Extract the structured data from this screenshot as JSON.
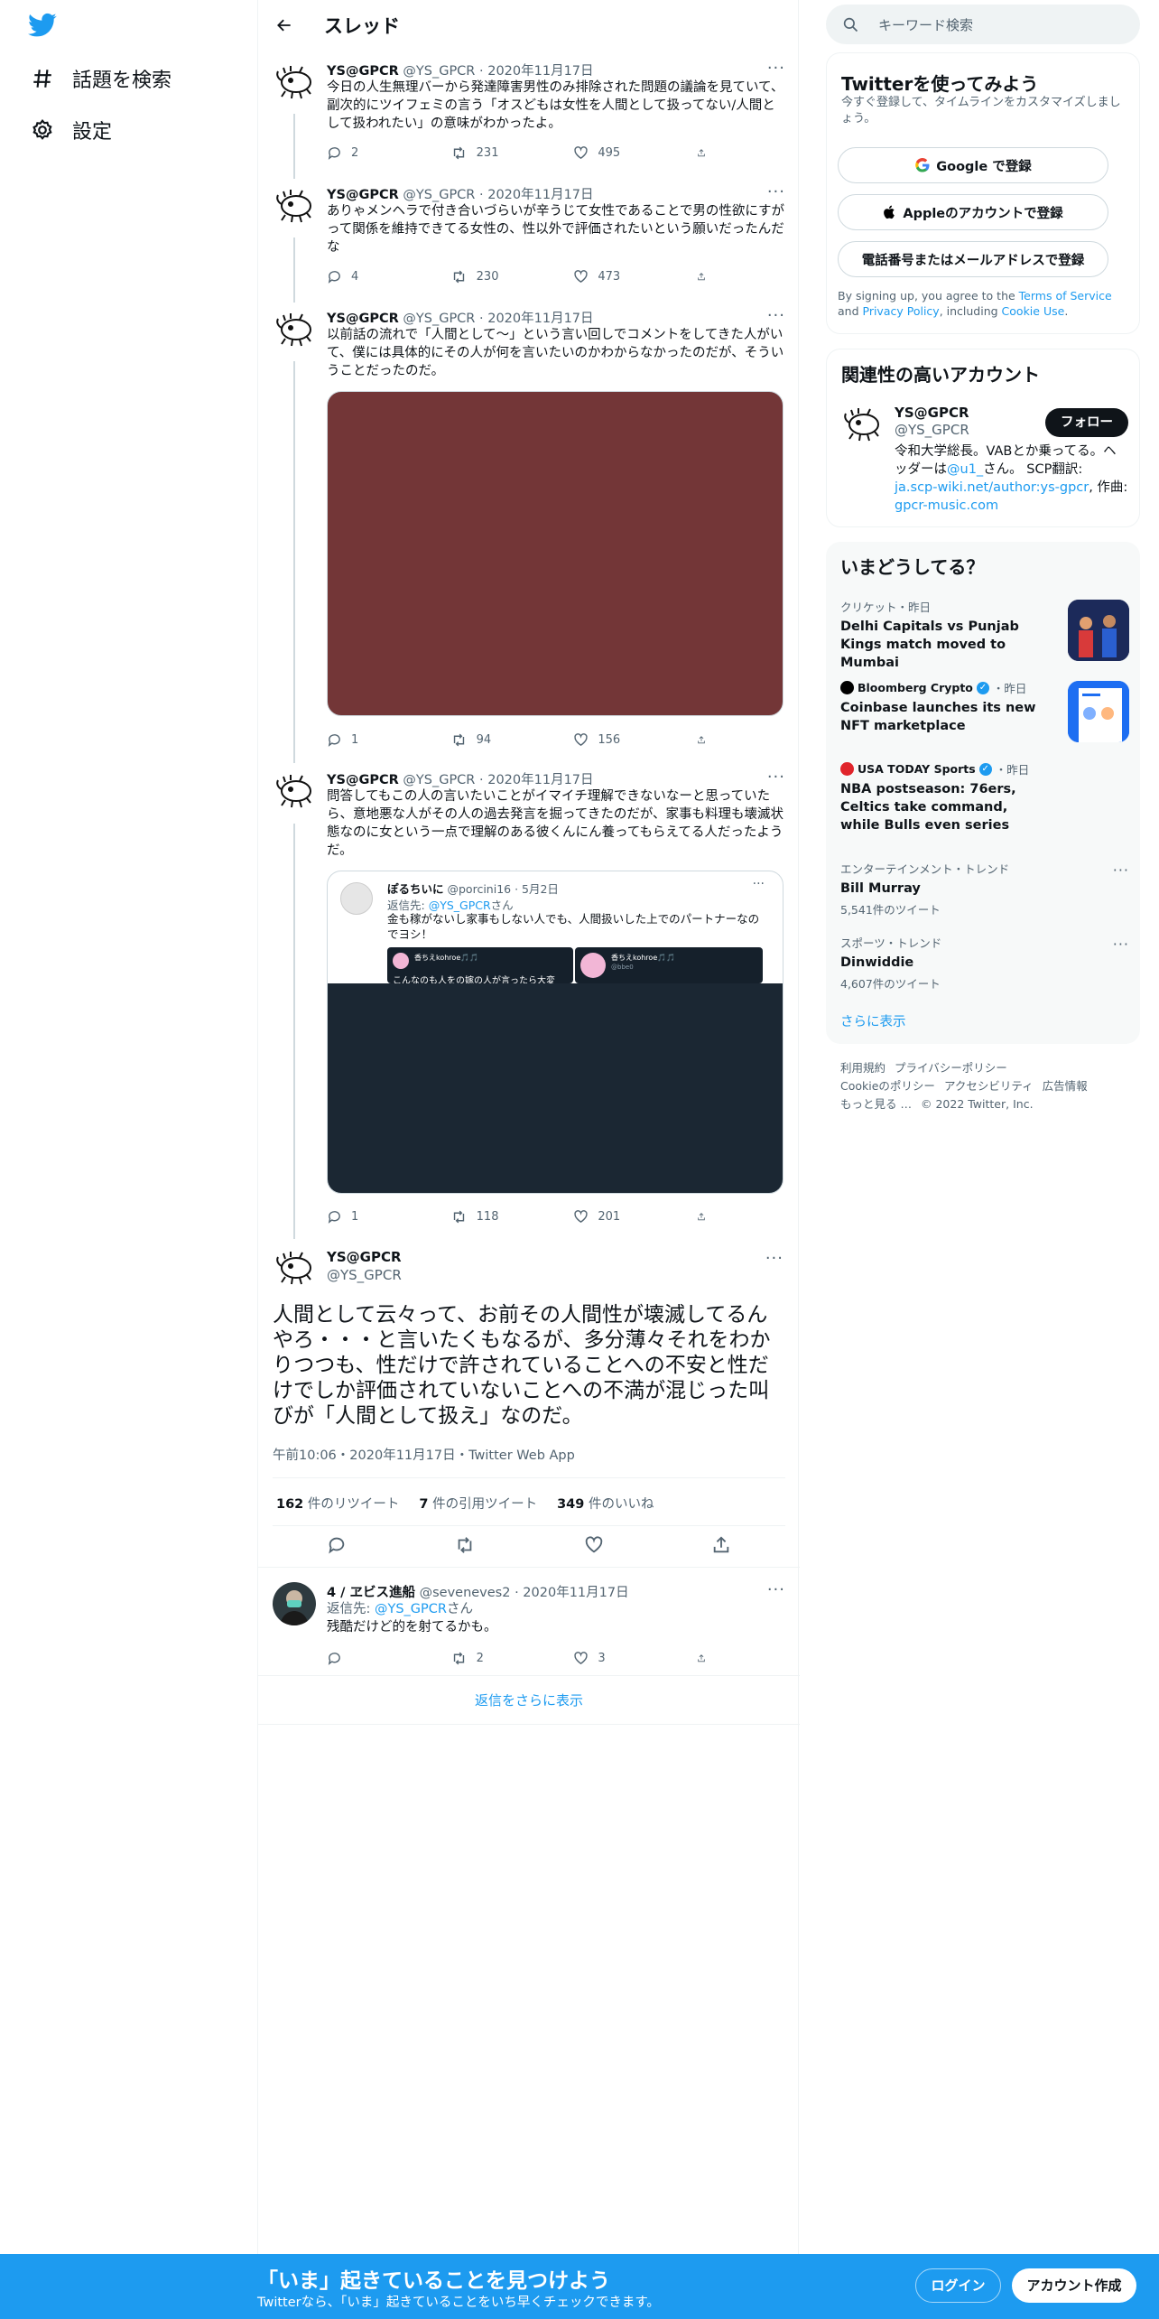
{
  "nav": {
    "logo": "twitter-bird",
    "explore_label": "話題を検索",
    "settings_label": "設定"
  },
  "header": {
    "title": "スレッド"
  },
  "tweets": [
    {
      "name": "YS@GPCR",
      "handle": "@YS_GPCR",
      "date": "2020年11月17日",
      "text": "今日の人生無理バーから発達障害男性のみ排除された問題の議論を見ていて、副次的にツイフェミの言う「オスどもは女性を人間として扱ってない/人間として扱われたい」の意味がわかったよ。",
      "replies": "2",
      "retweets": "231",
      "likes": "495"
    },
    {
      "name": "YS@GPCR",
      "handle": "@YS_GPCR",
      "date": "2020年11月17日",
      "text": "ありゃメンヘラで付き合いづらいが辛うじて女性であることで男の性欲にすがって関係を維持できてる女性の、性以外で評価されたいという願いだったんだな",
      "replies": "4",
      "retweets": "230",
      "likes": "473"
    },
    {
      "name": "YS@GPCR",
      "handle": "@YS_GPCR",
      "date": "2020年11月17日",
      "text": "以前話の流れで「人間として～」という言い回しでコメントをしてきた人がいて、僕には具体的にその人が何を言いたいのかわからなかったのだが、そういうことだったのだ。",
      "replies": "1",
      "retweets": "94",
      "likes": "156"
    },
    {
      "name": "YS@GPCR",
      "handle": "@YS_GPCR",
      "date": "2020年11月17日",
      "text": "問答してもこの人の言いたいことがイマイチ理解できないなーと思っていたら、意地悪な人がその人の過去発言を掘ってきたのだが、家事も料理も壊滅状態なのに女という一点で理解のある彼くんにん養ってもらえてる人だったようだ。",
      "replies": "1",
      "retweets": "118",
      "likes": "201"
    }
  ],
  "quote": {
    "name": "ぽるちいに",
    "handle": "@porcini16",
    "date": "5月2日",
    "reply_to_prefix": "返信先: ",
    "reply_to": "@YS_GPCR",
    "reply_to_suffix": "さん",
    "text": "金も稼がないし家事もしない人でも、人間扱いした上でのパートナーなのでヨシ！",
    "thumb1_name": "香ちえkohroe🎵🎵",
    "thumb1_text": "こんなのも人をの嫁の人が言ったら大変",
    "thumb2_name": "香ちえkohroe🎵🎵",
    "thumb2_handle": "@bbe0"
  },
  "main": {
    "name": "YS@GPCR",
    "handle": "@YS_GPCR",
    "text": "人間として云々って、お前その人間性が壊滅してるんやろ・・・と言いたくもなるが、多分薄々それをわかりつつも、性だけで許されていることへの不安と性だけでしか評価されていないことへの不満が混じった叫びが「人間として扱え」なのだ。",
    "time": "午前10:06・2020年11月17日・Twitter Web App",
    "retweet_count": "162",
    "retweet_label": " 件のリツイート",
    "quote_count": "7",
    "quote_label": " 件の引用ツイート",
    "like_count": "349",
    "like_label": " 件のいいね"
  },
  "reply": {
    "name": "4 / ヱビス進船",
    "handle": "@seveneves2",
    "date": "2020年11月17日",
    "reply_to_prefix": "返信先: ",
    "reply_to": "@YS_GPCR",
    "reply_to_suffix": "さん",
    "text": "残酷だけど的を射てるかも。",
    "replies": "",
    "retweets": "2",
    "likes": "3"
  },
  "show_more_replies": "返信をさらに表示",
  "search": {
    "placeholder": "キーワード検索"
  },
  "signup": {
    "title": "Twitterを使ってみよう",
    "desc": "今すぐ登録して、タイムラインをカスタマイズしましょう。",
    "google": "Google で登録",
    "apple": "Appleのアカウントで登録",
    "phone": "電話番号またはメールアドレスで登録",
    "terms_pre": "By signing up, you agree to the ",
    "terms_link": "Terms of Service",
    "terms_mid": " and ",
    "privacy_link": "Privacy Policy",
    "terms_mid2": ", including ",
    "cookie_link": "Cookie Use",
    "terms_end": "."
  },
  "related": {
    "title": "関連性の高いアカウント",
    "name": "YS@GPCR",
    "handle": "@YS_GPCR",
    "follow": "フォロー",
    "bio_1": "令和大学総長。VABとか乗ってる。ヘッダーは",
    "bio_link1": "@u1_",
    "bio_2": "さん。 SCP翻訳: ",
    "bio_link2": "ja.scp-wiki.net/author:ys-gpcr",
    "bio_3": ", 作曲: ",
    "bio_link3": "gpcr-music.com"
  },
  "trends": {
    "title": "いまどうしてる？",
    "items": [
      {
        "meta": "クリケット・昨日",
        "title": "Delhi Capitals vs Punjab Kings match moved to Mumbai"
      },
      {
        "source": "Bloomberg Crypto",
        "meta": "・昨日",
        "title": "Coinbase launches its new NFT marketplace"
      },
      {
        "source": "USA TODAY Sports",
        "meta": "・昨日",
        "title": "NBA postseason: 76ers, Celtics take command, while Bulls even series"
      },
      {
        "meta": "エンターテインメント・トレンド",
        "title": "Bill Murray",
        "count": "5,541件のツイート"
      },
      {
        "meta": "スポーツ・トレンド",
        "title": "Dinwiddie",
        "count": "4,607件のツイート"
      }
    ],
    "show_more": "さらに表示"
  },
  "footer": {
    "terms": "利用規約",
    "privacy": "プライバシーポリシー",
    "cookie": "Cookieのポリシー",
    "accessibility": "アクセシビリティ",
    "ads": "広告情報",
    "more": "もっと見る …",
    "copyright": "© 2022 Twitter, Inc."
  },
  "bottom": {
    "title": "「いま」起きていることを見つけよう",
    "subtitle": "Twitterなら、「いま」起きていることをいち早くチェックできます。",
    "login": "ログイン",
    "signup": "アカウント作成"
  },
  "colors": {
    "brand": "#1d9bf0",
    "text": "#0f1419",
    "muted": "#536471",
    "media1": "#733637",
    "media_dark": "#1b2733"
  }
}
